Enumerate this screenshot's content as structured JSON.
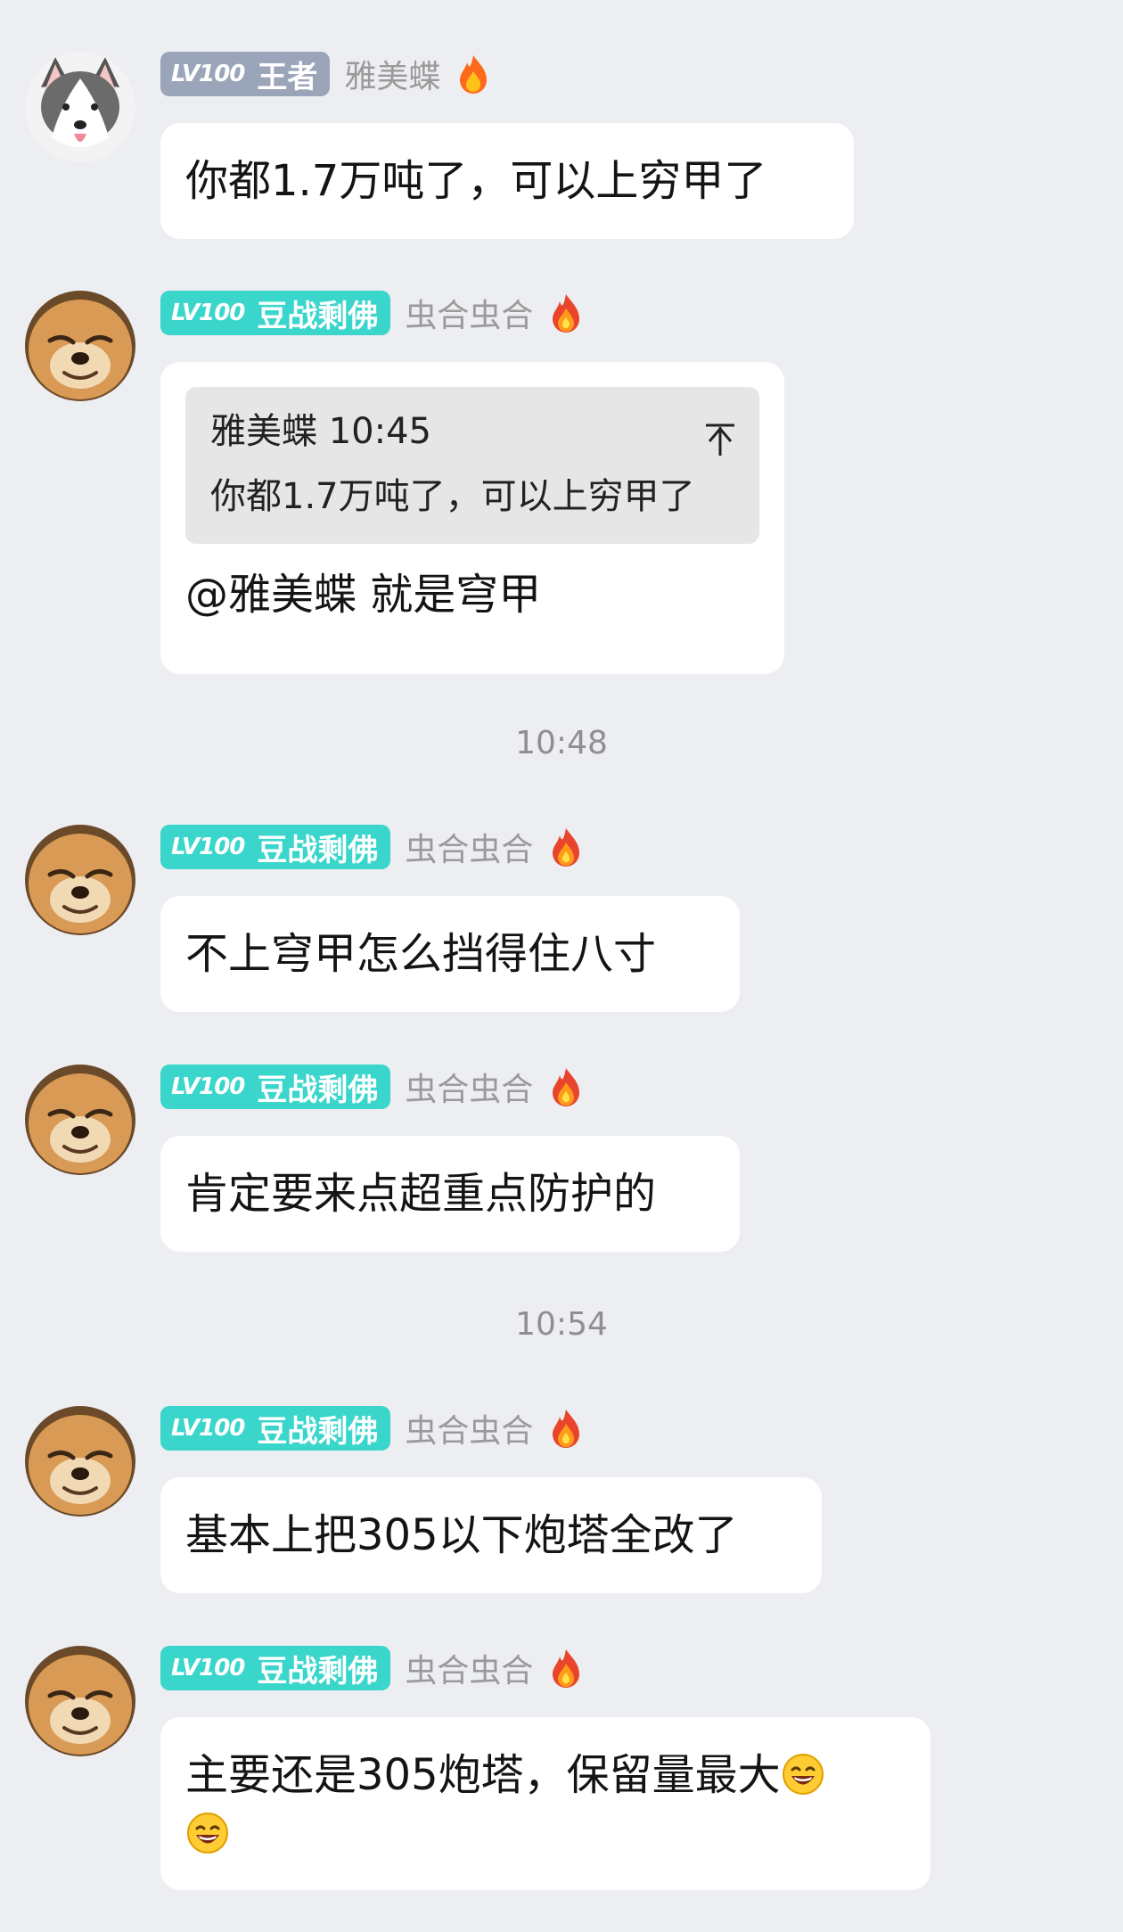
{
  "messages": [
    {
      "badge_level": "LV100",
      "badge_title": "王者",
      "nickname": "雅美蝶",
      "text": "你都1.7万吨了，可以上穷甲了"
    },
    {
      "badge_level": "LV100",
      "badge_title": "豆战剩佛",
      "nickname": "虫合虫合",
      "quote_header": "雅美蝶 10:45",
      "quote_text": "你都1.7万吨了，可以上穷甲了",
      "text": "@雅美蝶 就是穹甲"
    },
    {
      "badge_level": "LV100",
      "badge_title": "豆战剩佛",
      "nickname": "虫合虫合",
      "text": "不上穹甲怎么挡得住八寸"
    },
    {
      "badge_level": "LV100",
      "badge_title": "豆战剩佛",
      "nickname": "虫合虫合",
      "text": "肯定要来点超重点防护的"
    },
    {
      "badge_level": "LV100",
      "badge_title": "豆战剩佛",
      "nickname": "虫合虫合",
      "text": "基本上把305以下炮塔全改了"
    },
    {
      "badge_level": "LV100",
      "badge_title": "豆战剩佛",
      "nickname": "虫合虫合",
      "text": "主要还是305炮塔，保留量最大"
    }
  ],
  "timestamps": [
    "10:48",
    "10:54"
  ],
  "colors": {
    "background": "#edeef2",
    "badge_king": "#9aa5b9",
    "badge_teal": "#3ad6cc",
    "bubble": "#ffffff",
    "quote": "#e6e6e6"
  },
  "icons": {
    "flame": "flame-icon",
    "quote_jump": "jump-to-top-icon",
    "emoji": "grinning-sweat-emoji"
  }
}
